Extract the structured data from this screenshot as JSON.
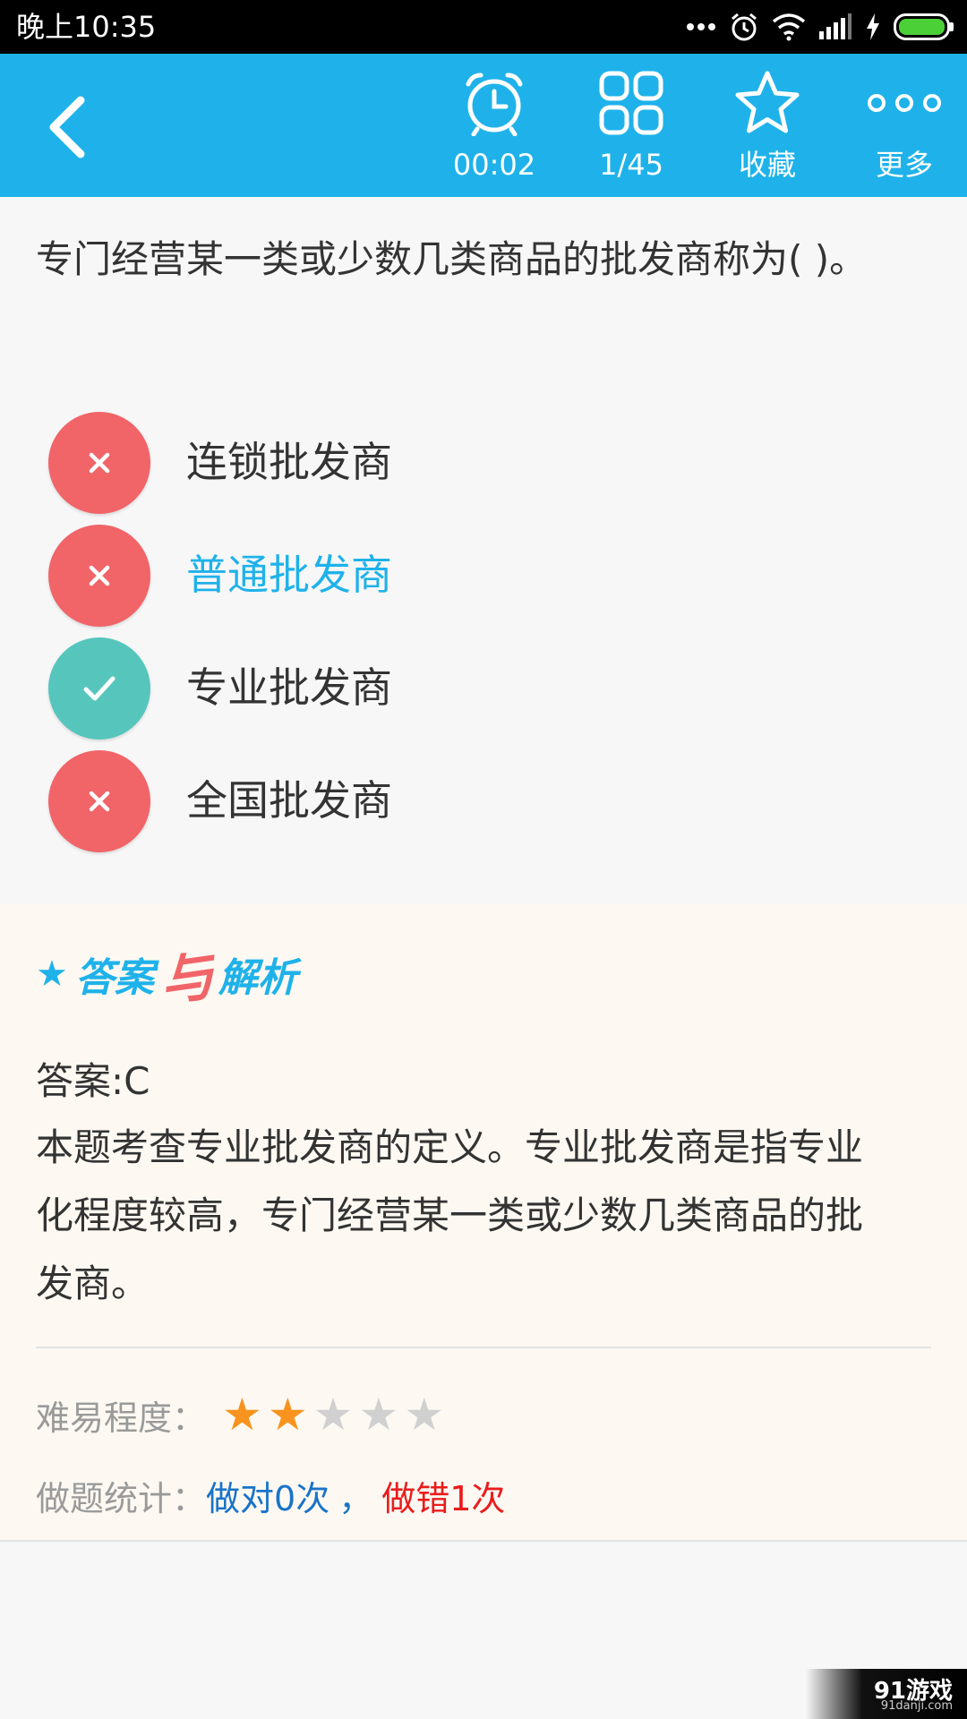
{
  "status_bar": {
    "time": "晚上10:35",
    "icons": [
      "more-dots-icon",
      "alarm-icon",
      "wifi-icon",
      "signal-icon",
      "charging-icon",
      "battery-icon"
    ]
  },
  "toolbar": {
    "back_icon": "back-arrow-icon",
    "timer": {
      "icon": "alarm-clock-icon",
      "label": "00:02"
    },
    "progress": {
      "icon": "grid-icon",
      "label": "1/45"
    },
    "favorite": {
      "icon": "star-outline-icon",
      "label": "收藏"
    },
    "more": {
      "icon": "more-icon",
      "label": "更多"
    }
  },
  "question": {
    "text": "专门经营某一类或少数几类商品的批发商称为(    )。"
  },
  "options": [
    {
      "text": "连锁批发商",
      "state": "wrong",
      "selected": false
    },
    {
      "text": "普通批发商",
      "state": "wrong",
      "selected": true
    },
    {
      "text": "专业批发商",
      "state": "correct",
      "selected": false
    },
    {
      "text": "全国批发商",
      "state": "wrong",
      "selected": false
    }
  ],
  "analysis": {
    "title_part1": "答案",
    "title_connector": "与",
    "title_part2": "解析",
    "answer": "答案:C",
    "explanation": "本题考查专业批发商的定义。专业批发商是指专业化程度较高，专门经营某一类或少数几类商品的批发商。",
    "difficulty_label": "难易程度：",
    "difficulty_stars": 2,
    "difficulty_max": 5,
    "stats_label": "做题统计：",
    "stats_right": "做对0次",
    "stats_separator": "，",
    "stats_wrong": "做错1次"
  },
  "colors": {
    "accent": "#1fb2ea",
    "wrong": "#f16468",
    "correct": "#56c6bd",
    "star_filled": "#f7931e",
    "star_empty": "#d0d0d0"
  },
  "watermark": {
    "main": "91游戏",
    "sub": "91danji.com"
  }
}
